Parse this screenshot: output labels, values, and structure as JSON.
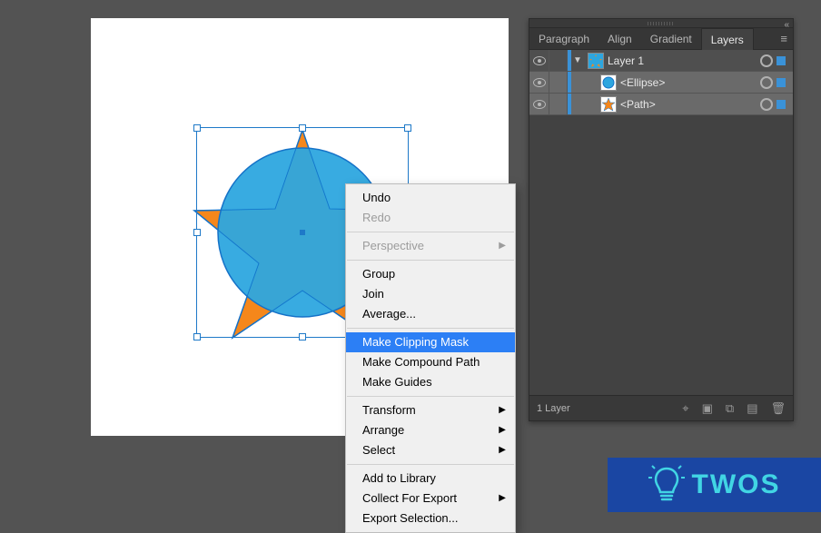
{
  "artwork": {
    "shapes": {
      "star": {
        "fill": "#f5871b",
        "stroke": "#1572c8"
      },
      "ellipse": {
        "fill": "#2da6df",
        "stroke": "#1572c8"
      }
    },
    "selection_color": "#1E79C8"
  },
  "context_menu": {
    "items": [
      {
        "label": "Undo",
        "enabled": true,
        "separator_after": false
      },
      {
        "label": "Redo",
        "enabled": false,
        "separator_after": true
      },
      {
        "label": "Perspective",
        "enabled": false,
        "submenu": true,
        "separator_after": true
      },
      {
        "label": "Group",
        "enabled": true
      },
      {
        "label": "Join",
        "enabled": true
      },
      {
        "label": "Average...",
        "enabled": true,
        "separator_after": true
      },
      {
        "label": "Make Clipping Mask",
        "enabled": true,
        "highlighted": true
      },
      {
        "label": "Make Compound Path",
        "enabled": true
      },
      {
        "label": "Make Guides",
        "enabled": true,
        "separator_after": true
      },
      {
        "label": "Transform",
        "enabled": true,
        "submenu": true
      },
      {
        "label": "Arrange",
        "enabled": true,
        "submenu": true
      },
      {
        "label": "Select",
        "enabled": true,
        "submenu": true,
        "separator_after": true
      },
      {
        "label": "Add to Library",
        "enabled": true
      },
      {
        "label": "Collect For Export",
        "enabled": true,
        "submenu": true
      },
      {
        "label": "Export Selection...",
        "enabled": true
      }
    ]
  },
  "panel": {
    "tabs": [
      "Paragraph",
      "Align",
      "Gradient",
      "Layers"
    ],
    "active_tab": "Layers",
    "layer": {
      "name": "Layer 1",
      "visible": true,
      "expanded": true,
      "selected": true,
      "color": "#3a92d8",
      "sublayers": [
        {
          "name": "<Ellipse>",
          "visible": true,
          "selected": true
        },
        {
          "name": "<Path>",
          "visible": true,
          "selected": true
        }
      ]
    },
    "footer_label": "1 Layer"
  },
  "watermark": {
    "text": "TWOS",
    "background": "#1a46a3",
    "text_color": "#41d5e4"
  }
}
